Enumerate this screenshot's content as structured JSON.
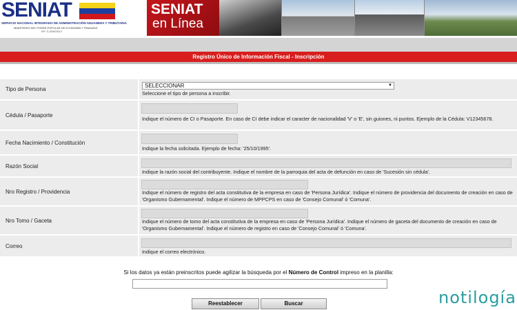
{
  "header": {
    "logo_word": "SENIAT",
    "logo_sub1": "SERVICIO NACIONAL INTEGRADO DE ADMINISTRACIÓN ADUANERA Y TRIBUTARIA",
    "logo_sub2": "MINISTERIO DEL PODER POPULAR DE ECONOMÍA Y FINANZAS",
    "logo_sub3": "RIF: G-20000303-0",
    "banner_line1": "SENIAT",
    "banner_line2": "en Línea"
  },
  "page_title": "Registro Único de Información Fiscal - Inscripción",
  "form": {
    "tipo_persona": {
      "label": "Tipo de Persona",
      "select_value": "SELECCIONAR",
      "hint": "Seleccione el tipo de persona a inscribir."
    },
    "cedula": {
      "label": "Cédula / Pasaporte",
      "value": "",
      "hint": "Indique el número de CI o Pasaporte. En caso de CI debe indicar el caracter de nacionalidad 'V' o 'E', sin guiones, ni puntos. Ejemplo de la Cédula: V12345678."
    },
    "fecha": {
      "label": "Fecha Nacimiento / Constitución",
      "value": "",
      "hint": "Indique la fecha solicitada. Ejemplo de fecha: '25/10/1995'."
    },
    "razon_social": {
      "label": "Razón Social",
      "value": "",
      "hint": "Indique la razón social del contribuyente. Indique el nombre de la parroquia del acta de defunción en caso de 'Sucesión sin cédula'."
    },
    "nro_registro": {
      "label": "Nro Registro / Providencia",
      "value": "",
      "hint": "Indique el número de registro del acta constitutiva de la empresa en caso de 'Persona Jurídica'. Indique el número de providencia del documento de creación en caso de 'Organismo Gubernamental'. Indique el número de MPPCPS en caso de 'Consejo Comunal' ó 'Comuna'."
    },
    "nro_tomo": {
      "label": "Nro Tomo / Gaceta",
      "value": "",
      "hint": "Indique el número de tomo del acta constitutiva de la empresa en caso de 'Persona Jurídica'. Indique el número de gaceta del documento de creación en caso de 'Organismo Gubernamental'. Indique el número de registro en caso de 'Consejo Comunal' ó 'Comuna'."
    },
    "correo": {
      "label": "Correo",
      "value": "",
      "hint": "Indique el correo electrónico."
    }
  },
  "search": {
    "text_before": "Si los datos ya están preinscritos puede agilizar la búsqueda por el ",
    "text_bold": "Número de Control",
    "text_after": " impreso en la planilla:",
    "value": ""
  },
  "buttons": {
    "reset": "Reestablecer",
    "search": "Buscar"
  },
  "watermark": "notilogía"
}
